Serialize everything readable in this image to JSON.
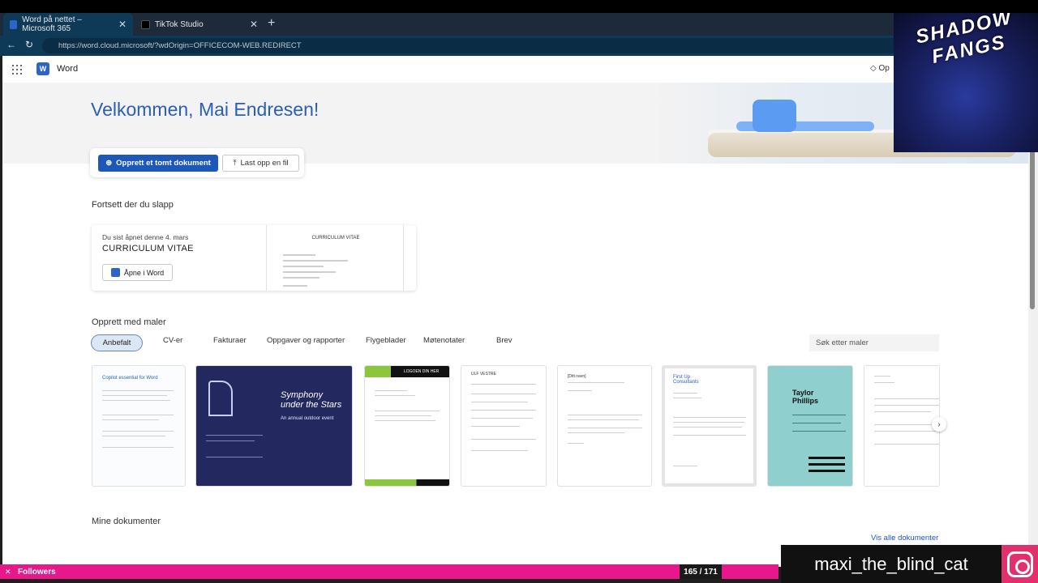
{
  "browser": {
    "tabs": [
      {
        "title": "Word på nettet – Microsoft 365",
        "active": true
      },
      {
        "title": "TikTok Studio",
        "active": false
      }
    ],
    "url": "https://word.cloud.microsoft/?wdOrigin=OFFICECOM-WEB.REDIRECT"
  },
  "app": {
    "name": "Word",
    "premium_label": "Op"
  },
  "hero": {
    "welcome": "Velkommen, Mai Endresen!",
    "btn_new": "Opprett et tomt dokument",
    "btn_upload": "Last opp en fil"
  },
  "continue": {
    "title": "Fortsett der du slapp",
    "opened_prefix": "Du sist åpnet",
    "opened_date": "denne 4. mars",
    "doc_title": "CURRICULUM VITAE",
    "open_in_word": "Åpne i Word",
    "preview_title": "CURRICULUM VITAE"
  },
  "templates": {
    "title": "Opprett med maler",
    "tabs": [
      "Anbefalt",
      "CV-er",
      "Fakturaer",
      "Oppgaver og rapporter",
      "Flygeblader",
      "Møtenotater",
      "Brev"
    ],
    "search_placeholder": "Søk etter maler",
    "cards": [
      {
        "heading": "Copilot essential for Word",
        "bg": "#ffffff"
      },
      {
        "heading": "Symphony under the Stars",
        "sub": "An annual outdoor event",
        "bg": "#23295e"
      },
      {
        "heading": "LOGOEN DIN HER",
        "bg": "#ffffff"
      },
      {
        "heading": "ULF VESTRE",
        "bg": "#ffffff"
      },
      {
        "heading": "[Ditt navn]",
        "bg": "#ffffff"
      },
      {
        "heading": "First Up Consultants",
        "bg": "#ffffff"
      },
      {
        "heading": "Taylor Phillips",
        "bg": "#8fd0cf"
      },
      {
        "heading": "",
        "bg": "#ffffff"
      }
    ]
  },
  "mydocs": {
    "title": "Mine dokumenter",
    "see_all": "Vis alle dokumenter"
  },
  "overlay": {
    "logo_text": "SHADOW FANGS",
    "followers_label": "Followers",
    "followers_count": "165 / 171",
    "username": "maxi_the_blind_cat"
  },
  "colors": {
    "accent": "#1d58b8",
    "welcome": "#2b5fb3",
    "followers_bar": "#e8188a"
  }
}
